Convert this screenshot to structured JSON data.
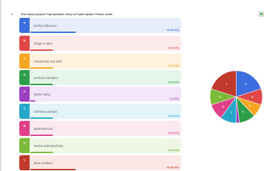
{
  "question": {
    "number": "1.",
    "text": "Tieto názvy vymyslel Tvoji spolužiaci. Ktorý sa Ti páči najviac? Prosím, označ."
  },
  "options": [
    {
      "badge": "a)",
      "label": "Knižný influencer",
      "count": "10 (20.0%)",
      "pct": 20,
      "badge_color": "#3c6ee0",
      "bg": "#e8edfb",
      "count_color": "#3c6ee0"
    },
    {
      "badge": "b)",
      "label": "Čítajte s nami",
      "count": "5 (10.0%)",
      "pct": 10,
      "badge_color": "#e04747",
      "bg": "#fdeaea",
      "count_color": "#e04747"
    },
    {
      "badge": "c)",
      "label": "Fantastický svet kníh",
      "count": "4 (10.0%)",
      "pct": 10,
      "badge_color": "#f5a623",
      "bg": "#fff3e0",
      "count_color": "#f0a020"
    },
    {
      "badge": "d)",
      "label": "Knižnica zázrakov",
      "count": "5 (10.0%)",
      "pct": 10,
      "badge_color": "#2e9e4a",
      "bg": "#e6f5ea",
      "count_color": "#2e9e4a"
    },
    {
      "badge": "e)",
      "label": "Múdre knihy",
      "count": "1 (2.0%)",
      "pct": 2,
      "badge_color": "#9c3fc0",
      "bg": "#f4e6fa",
      "count_color": "#9c3fc0"
    },
    {
      "badge": "f)",
      "label": "Literárny podcast",
      "count": "5 (10.0%)",
      "pct": 10,
      "badge_color": "#25a7c9",
      "bg": "#e2f4fa",
      "count_color": "#25a7c9"
    },
    {
      "badge": "g)",
      "label": "Naša knižnica",
      "count": "5 (10.0%)",
      "pct": 10,
      "badge_color": "#e0408a",
      "bg": "#fce8f1",
      "count_color": "#e0408a"
    },
    {
      "badge": "h)",
      "label": "Knižné dobrodružstvá",
      "count": "5 (10.0%)",
      "pct": 10,
      "badge_color": "#7cba3a",
      "bg": "#eff7e4",
      "count_color": "#6aa62e"
    },
    {
      "badge": "i)",
      "label": "Život s knihou",
      "count": "10 (20.0%)",
      "pct": 20,
      "badge_color": "#c0392b",
      "bg": "#fbe7e5",
      "count_color": "#c0392b"
    }
  ],
  "chart_data": {
    "type": "pie",
    "categories": [
      "a)",
      "b)",
      "c)",
      "d)",
      "e)",
      "f)",
      "g)",
      "h)",
      "i)"
    ],
    "values": [
      10,
      5,
      4,
      5,
      1,
      5,
      5,
      5,
      10
    ],
    "colors": [
      "#3c6ee0",
      "#e04747",
      "#f5a623",
      "#2e9e4a",
      "#9c3fc0",
      "#25a7c9",
      "#e0408a",
      "#7cba3a",
      "#c0392b"
    ]
  }
}
